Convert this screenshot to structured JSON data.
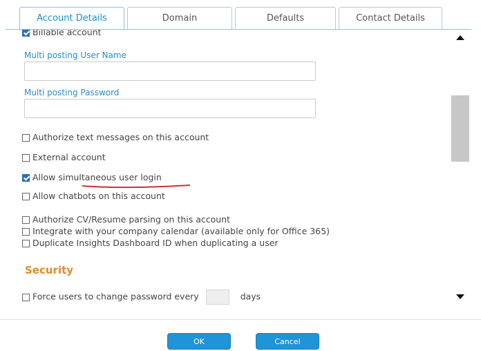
{
  "tabs": [
    {
      "label": "Account Details",
      "active": true
    },
    {
      "label": "Domain",
      "active": false
    },
    {
      "label": "Defaults",
      "active": false
    },
    {
      "label": "Contact Details",
      "active": false
    }
  ],
  "form": {
    "billable": {
      "label": "Billable account",
      "checked": true
    },
    "multi_user": {
      "label": "Multi posting User Name",
      "value": ""
    },
    "multi_password": {
      "label": "Multi posting Password",
      "value": ""
    },
    "options": [
      {
        "label": "Authorize text messages on this account",
        "checked": false
      },
      {
        "label": "External account",
        "checked": false
      },
      {
        "label": "Allow simultaneous user login",
        "checked": true
      },
      {
        "label": "Allow chatbots on this account",
        "checked": false
      },
      {
        "label": "Authorize CV/Resume parsing on this account",
        "checked": false
      },
      {
        "label": "Integrate with your company calendar (available only for Office 365)",
        "checked": false
      },
      {
        "label": "Duplicate Insights Dashboard ID when duplicating a user",
        "checked": false
      }
    ],
    "security": {
      "title": "Security",
      "force_password": {
        "label": "Force users to change password every",
        "checked": false,
        "days_value": "",
        "unit": "days"
      }
    }
  },
  "footer": {
    "ok_label": "OK",
    "cancel_label": "Cancel"
  },
  "colors": {
    "accent": "#1f94d8",
    "label_blue": "#2a8ccc",
    "section_orange": "#e08a2c",
    "annotation_red": "#d0302f"
  }
}
